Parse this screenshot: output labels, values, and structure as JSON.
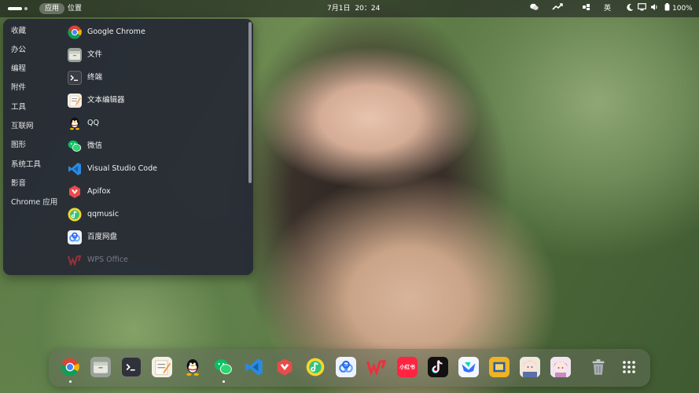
{
  "topbar": {
    "apps_label": "应用",
    "places_label": "位置",
    "date": "7月1日",
    "time": "20：24",
    "input_method": "英",
    "battery": "100%"
  },
  "menu": {
    "categories": [
      "收藏",
      "办公",
      "编程",
      "附件",
      "工具",
      "互联网",
      "图形",
      "系统工具",
      "影音",
      "Chrome 应用"
    ],
    "apps": [
      {
        "label": "Google Chrome",
        "icon": "chrome-icon"
      },
      {
        "label": "文件",
        "icon": "files-icon"
      },
      {
        "label": "终端",
        "icon": "terminal-icon"
      },
      {
        "label": "文本编辑器",
        "icon": "text-editor-icon"
      },
      {
        "label": "QQ",
        "icon": "qq-icon"
      },
      {
        "label": "微信",
        "icon": "wechat-icon"
      },
      {
        "label": "Visual Studio Code",
        "icon": "vscode-icon"
      },
      {
        "label": "Apifox",
        "icon": "apifox-icon"
      },
      {
        "label": "qqmusic",
        "icon": "qqmusic-icon"
      },
      {
        "label": "百度网盘",
        "icon": "baidu-netdisk-icon"
      },
      {
        "label": "WPS Office",
        "icon": "wps-icon"
      }
    ]
  },
  "dock": {
    "items": [
      "chrome-icon",
      "files-icon",
      "terminal-icon",
      "text-editor-icon",
      "qq-icon",
      "wechat-icon",
      "vscode-icon",
      "apifox-icon",
      "qqmusic-icon",
      "baidu-netdisk-icon",
      "wps-icon",
      "xiaohongshu-icon",
      "tiktok-icon",
      "feishu-icon",
      "slideshow-icon",
      "anime-app-icon",
      "anime-app-2-icon",
      "trash-icon",
      "show-apps-icon"
    ],
    "xiaohongshu_label": "小红书"
  },
  "colors": {
    "panel": "#262935",
    "topbar": "#141418",
    "accent_green": "#07c160",
    "vscode_blue": "#2b8ae0",
    "wps_red": "#e8323c"
  }
}
